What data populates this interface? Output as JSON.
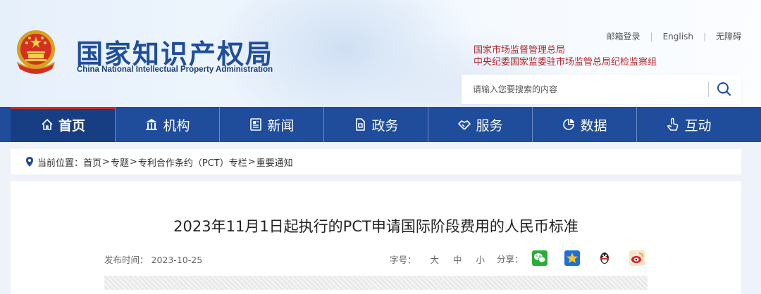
{
  "site": {
    "name_cn": "国家知识产权局",
    "name_en": "China National Intellectual Property Administration"
  },
  "toplinks": [
    "邮箱登录",
    "English",
    "无障碍"
  ],
  "parent_orgs": [
    "国家市场监督管理总局",
    "中央纪委国家监委驻市场监管总局纪检监察组"
  ],
  "search": {
    "placeholder": "请输入您要搜索的内容"
  },
  "nav": [
    {
      "label": "首页",
      "icon": "home-icon",
      "active": true
    },
    {
      "label": "机构",
      "icon": "building-icon"
    },
    {
      "label": "新闻",
      "icon": "newspaper-icon"
    },
    {
      "label": "政务",
      "icon": "document-icon"
    },
    {
      "label": "服务",
      "icon": "handshake-icon"
    },
    {
      "label": "数据",
      "icon": "pie-chart-icon"
    },
    {
      "label": "互动",
      "icon": "hand-pointer-icon"
    }
  ],
  "breadcrumb": {
    "prefix": "当前位置：",
    "items": [
      "首页",
      "专题",
      "专利合作条约（PCT）专栏",
      "重要通知"
    ],
    "separator": ">"
  },
  "article": {
    "title": "2023年11月1日起执行的PCT申请国际阶段费用的人民币标准",
    "publish_label": "发布时间：",
    "publish_date": "2023-10-25",
    "font_size_label": "字号：",
    "font_sizes": [
      "大",
      "中",
      "小"
    ],
    "share_label": "分享："
  },
  "colors": {
    "nav_bg": "#1f4d9c",
    "nav_active": "#173e82",
    "accent_red": "#c92a2a",
    "brand_blue": "#1f4e9c"
  }
}
